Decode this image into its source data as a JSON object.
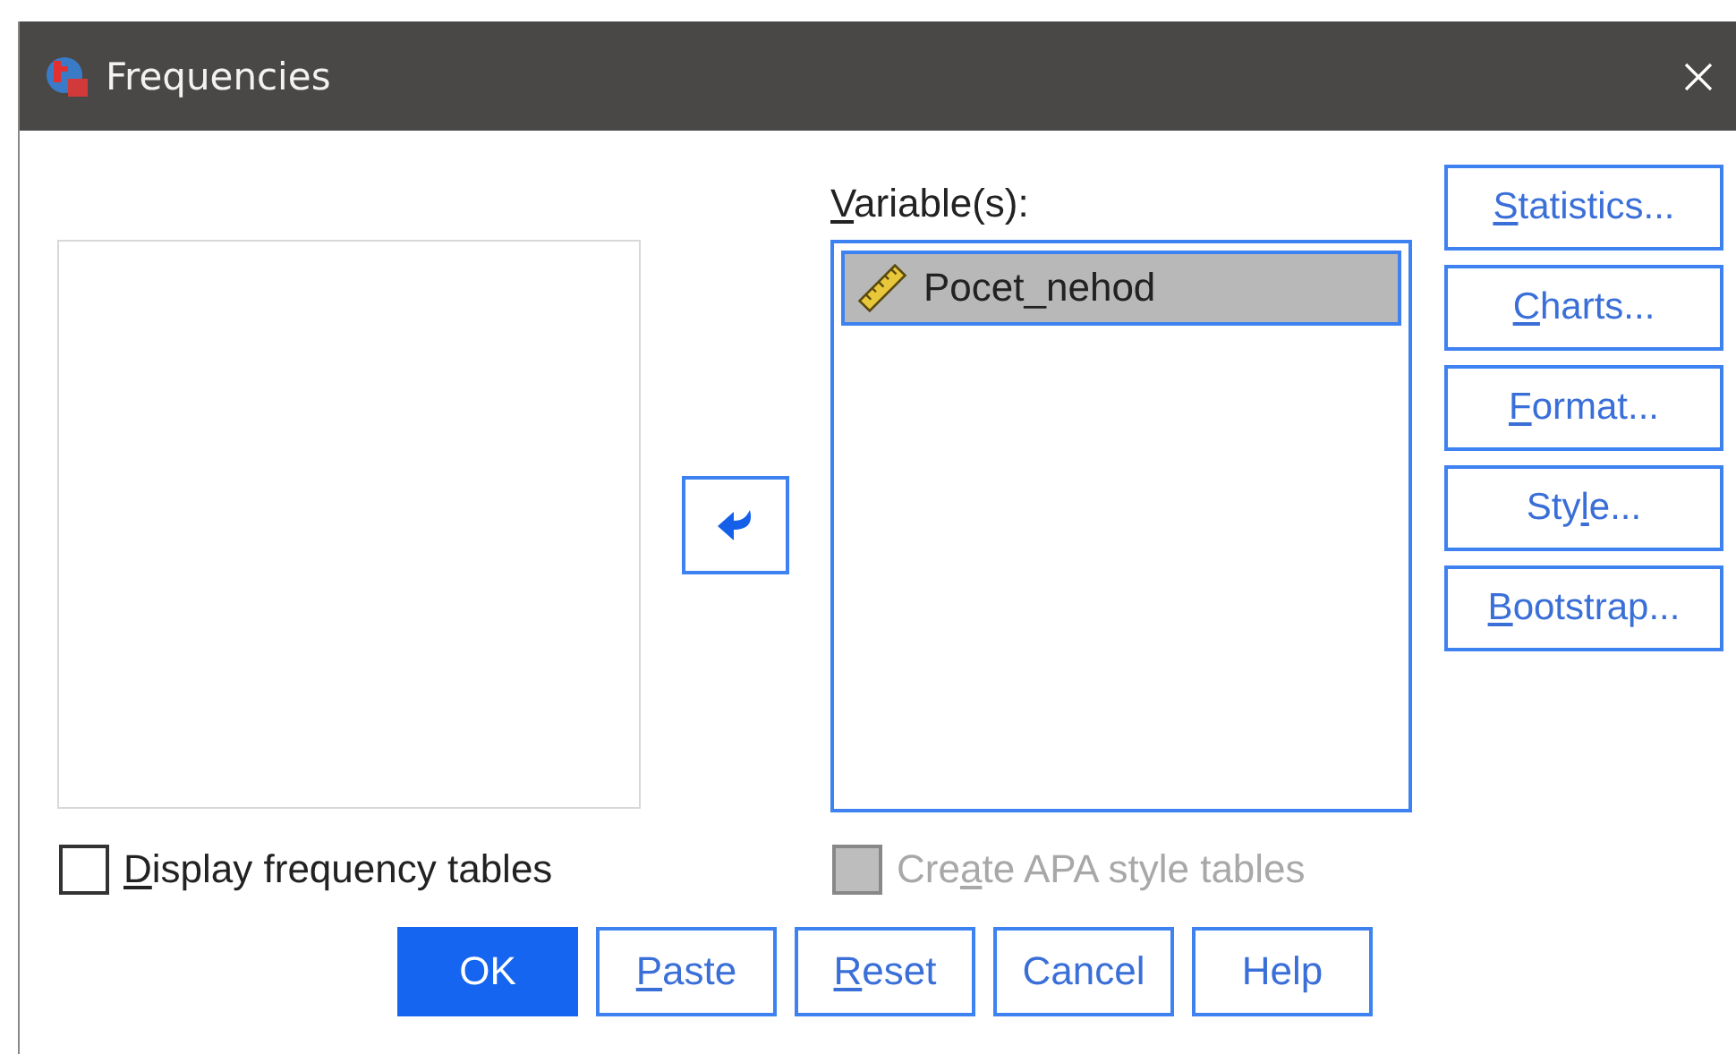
{
  "window": {
    "title": "Frequencies"
  },
  "variables": {
    "label": {
      "key": "V",
      "post": "ariable(s):"
    },
    "items": [
      {
        "name": "Pocet_nehod",
        "selected": true
      }
    ]
  },
  "side_buttons": [
    {
      "key": "S",
      "post": "tatistics..."
    },
    {
      "key": "C",
      "post": "harts..."
    },
    {
      "key": "F",
      "post": "ormat..."
    },
    {
      "pre": "Sty",
      "key": "l",
      "post": "e..."
    },
    {
      "key": "B",
      "post": "ootstrap..."
    }
  ],
  "options": [
    {
      "key": "D",
      "post": "isplay frequency tables",
      "checked": false,
      "disabled": false
    },
    {
      "pre": "Cre",
      "key": "a",
      "post": "te APA style tables",
      "checked": false,
      "disabled": true
    }
  ],
  "buttons": [
    {
      "pre": "OK",
      "default": true
    },
    {
      "key": "P",
      "post": "aste",
      "default": false
    },
    {
      "key": "R",
      "post": "eset",
      "default": false
    },
    {
      "pre": "Cancel",
      "default": false
    },
    {
      "pre": "Help",
      "default": false
    }
  ]
}
